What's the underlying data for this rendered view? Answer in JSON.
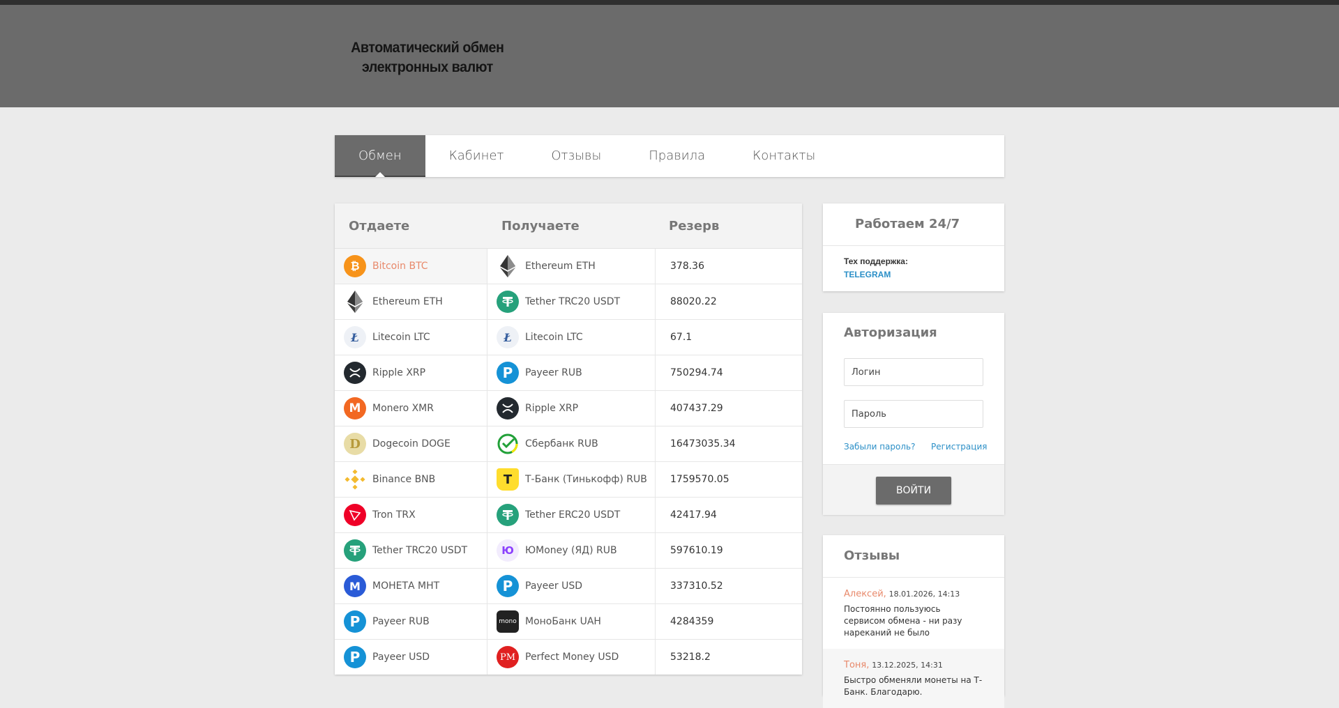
{
  "header": {
    "logo_line1": "Автоматический обмен",
    "logo_line2": "электронных валют"
  },
  "nav": [
    {
      "label": "Обмен",
      "active": true
    },
    {
      "label": "Кабинет"
    },
    {
      "label": "Отзывы"
    },
    {
      "label": "Правила"
    },
    {
      "label": "Контакты"
    }
  ],
  "table": {
    "headers": {
      "give": "Отдаете",
      "get": "Получаете",
      "reserve": "Резерв"
    },
    "rows": [
      {
        "give": "Bitcoin BTC",
        "give_icon": "bitcoin-icon",
        "get": "Ethereum ETH",
        "get_icon": "ethereum-icon",
        "reserve": "378.36"
      },
      {
        "give": "Ethereum ETH",
        "give_icon": "ethereum-icon",
        "get": "Tether TRC20 USDT",
        "get_icon": "tether-icon",
        "reserve": "88020.22"
      },
      {
        "give": "Litecoin LTC",
        "give_icon": "litecoin-icon",
        "get": "Litecoin LTC",
        "get_icon": "litecoin-icon",
        "reserve": "67.1"
      },
      {
        "give": "Ripple XRP",
        "give_icon": "ripple-icon",
        "get": "Payeer RUB",
        "get_icon": "payeer-icon",
        "reserve": "750294.74"
      },
      {
        "give": "Monero XMR",
        "give_icon": "monero-icon",
        "get": "Ripple XRP",
        "get_icon": "ripple-icon",
        "reserve": "407437.29"
      },
      {
        "give": "Dogecoin DOGE",
        "give_icon": "dogecoin-icon",
        "get": "Сбербанк RUB",
        "get_icon": "sberbank-icon",
        "reserve": "16473035.34"
      },
      {
        "give": "Binance BNB",
        "give_icon": "binance-icon",
        "get": "Т-Банк (Тинькофф) RUB",
        "get_icon": "tbank-icon",
        "reserve": "1759570.05"
      },
      {
        "give": "Tron TRX",
        "give_icon": "tron-icon",
        "get": "Tether ERC20 USDT",
        "get_icon": "tether-icon",
        "reserve": "42417.94"
      },
      {
        "give": "Tether TRC20 USDT",
        "give_icon": "tether-icon",
        "get": "ЮMoney (ЯД) RUB",
        "get_icon": "yoomoney-icon",
        "reserve": "597610.19"
      },
      {
        "give": "МОНЕТА МНТ",
        "give_icon": "moneta-icon",
        "get": "Payeer USD",
        "get_icon": "payeer-icon",
        "reserve": "337310.52"
      },
      {
        "give": "Payeer RUB",
        "give_icon": "payeer-icon",
        "get": "МоноБанк UAH",
        "get_icon": "monobank-icon",
        "reserve": "4284359"
      },
      {
        "give": "Payeer USD",
        "give_icon": "payeer-icon",
        "get": "Perfect Money USD",
        "get_icon": "perfect-money-icon",
        "reserve": "53218.2"
      }
    ]
  },
  "work": {
    "title": "Работаем 24/7",
    "support_label": "Тех поддержка:",
    "telegram": "TELEGRAM"
  },
  "auth": {
    "title": "Авторизация",
    "login_placeholder": "Логин",
    "password_placeholder": "Пароль",
    "forgot": "Забыли пароль?",
    "register": "Регистрация",
    "submit": "ВОЙТИ"
  },
  "reviews": {
    "title": "Отзывы",
    "items": [
      {
        "name": "Алексей,",
        "date": "18.01.2026, 14:13",
        "text": "Постоянно пользуюсь сервисом обмена - ни разу нареканий не было"
      },
      {
        "name": "Тоня,",
        "date": "13.12.2025, 14:31",
        "text": "Быстро обменяли монеты на Т-Банк. Благодарю."
      }
    ]
  },
  "colors": {
    "header_bg": "#6b6b6b",
    "accent_link": "#2b8fc7",
    "selected_text": "#e8896b"
  }
}
